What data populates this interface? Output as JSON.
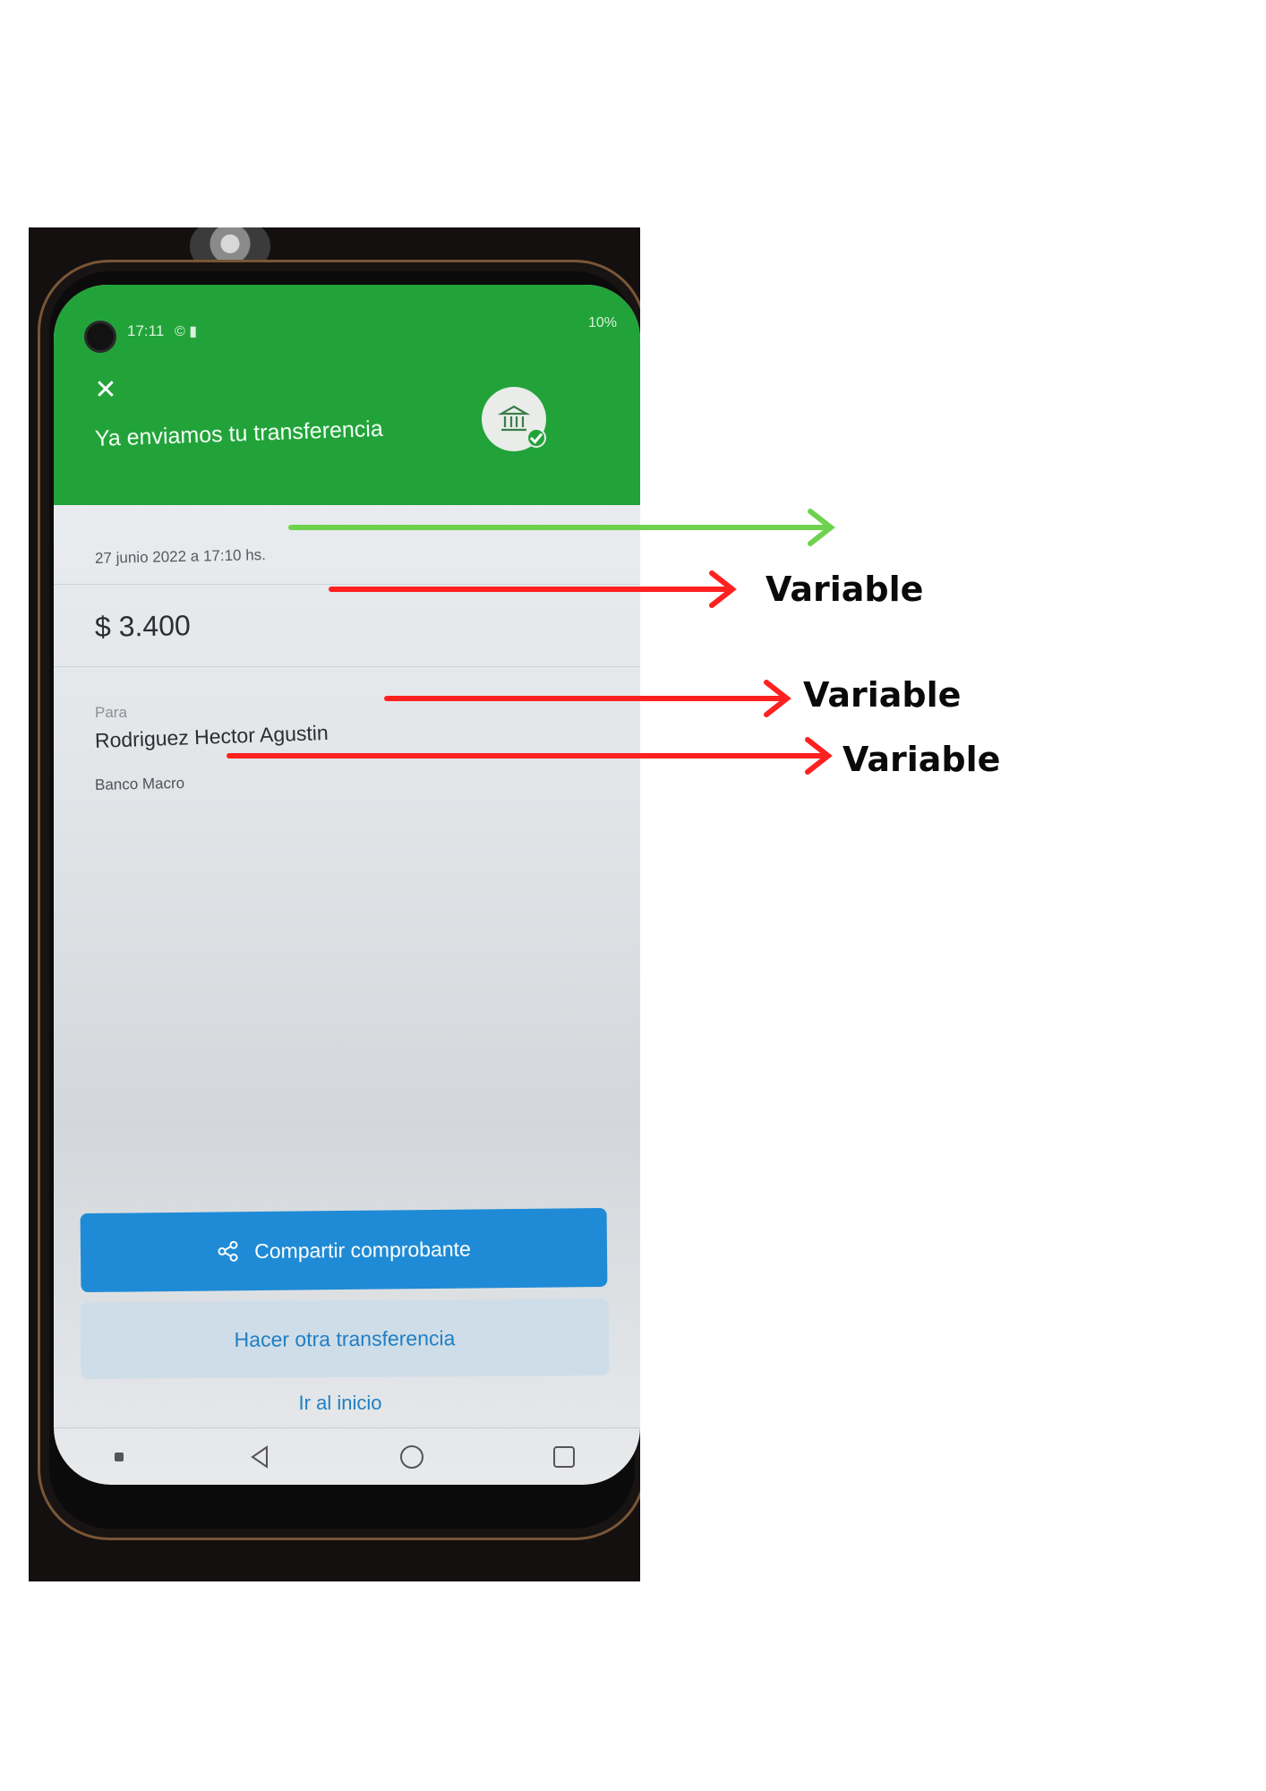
{
  "status_bar": {
    "time": "17:11",
    "left_icons": "© ▮",
    "battery": "10%"
  },
  "header": {
    "title": "Ya enviamos tu transferencia",
    "close_icon": "close-icon",
    "badge_icon": "bank-icon"
  },
  "receipt": {
    "date": "27 junio 2022 a 17:10 hs.",
    "amount": "$ 3.400",
    "to_label": "Para",
    "recipient": "Rodriguez Hector Agustin",
    "bank": "Banco Macro"
  },
  "actions": {
    "share_label": "Compartir comprobante",
    "another_label": "Hacer otra transferencia",
    "home_label": "Ir al inicio"
  },
  "annotations": {
    "amount_note": "Variable",
    "recipient_note": "Variable",
    "bank_note": "Variable"
  },
  "colors": {
    "header_green": "#22a33a",
    "primary_blue": "#1f8bd6",
    "arrow_green": "#6fd24e",
    "arrow_red": "#ff2020"
  }
}
